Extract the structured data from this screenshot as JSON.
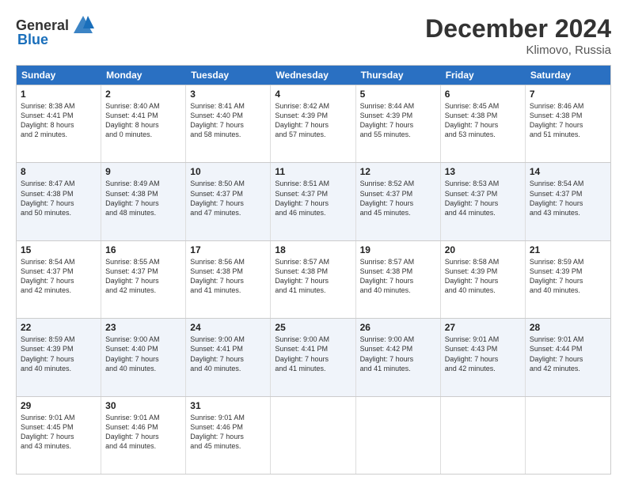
{
  "logo": {
    "general": "General",
    "blue": "Blue"
  },
  "title": "December 2024",
  "location": "Klimovo, Russia",
  "days_of_week": [
    "Sunday",
    "Monday",
    "Tuesday",
    "Wednesday",
    "Thursday",
    "Friday",
    "Saturday"
  ],
  "weeks": [
    [
      {
        "day": "1",
        "sunrise": "8:38 AM",
        "sunset": "4:41 PM",
        "daylight": "8 hours and 2 minutes."
      },
      {
        "day": "2",
        "sunrise": "8:40 AM",
        "sunset": "4:41 PM",
        "daylight": "8 hours and 0 minutes."
      },
      {
        "day": "3",
        "sunrise": "8:41 AM",
        "sunset": "4:40 PM",
        "daylight": "7 hours and 58 minutes."
      },
      {
        "day": "4",
        "sunrise": "8:42 AM",
        "sunset": "4:39 PM",
        "daylight": "7 hours and 57 minutes."
      },
      {
        "day": "5",
        "sunrise": "8:44 AM",
        "sunset": "4:39 PM",
        "daylight": "7 hours and 55 minutes."
      },
      {
        "day": "6",
        "sunrise": "8:45 AM",
        "sunset": "4:38 PM",
        "daylight": "7 hours and 53 minutes."
      },
      {
        "day": "7",
        "sunrise": "8:46 AM",
        "sunset": "4:38 PM",
        "daylight": "7 hours and 51 minutes."
      }
    ],
    [
      {
        "day": "8",
        "sunrise": "8:47 AM",
        "sunset": "4:38 PM",
        "daylight": "7 hours and 50 minutes."
      },
      {
        "day": "9",
        "sunrise": "8:49 AM",
        "sunset": "4:38 PM",
        "daylight": "7 hours and 48 minutes."
      },
      {
        "day": "10",
        "sunrise": "8:50 AM",
        "sunset": "4:37 PM",
        "daylight": "7 hours and 47 minutes."
      },
      {
        "day": "11",
        "sunrise": "8:51 AM",
        "sunset": "4:37 PM",
        "daylight": "7 hours and 46 minutes."
      },
      {
        "day": "12",
        "sunrise": "8:52 AM",
        "sunset": "4:37 PM",
        "daylight": "7 hours and 45 minutes."
      },
      {
        "day": "13",
        "sunrise": "8:53 AM",
        "sunset": "4:37 PM",
        "daylight": "7 hours and 44 minutes."
      },
      {
        "day": "14",
        "sunrise": "8:54 AM",
        "sunset": "4:37 PM",
        "daylight": "7 hours and 43 minutes."
      }
    ],
    [
      {
        "day": "15",
        "sunrise": "8:54 AM",
        "sunset": "4:37 PM",
        "daylight": "7 hours and 42 minutes."
      },
      {
        "day": "16",
        "sunrise": "8:55 AM",
        "sunset": "4:37 PM",
        "daylight": "7 hours and 42 minutes."
      },
      {
        "day": "17",
        "sunrise": "8:56 AM",
        "sunset": "4:38 PM",
        "daylight": "7 hours and 41 minutes."
      },
      {
        "day": "18",
        "sunrise": "8:57 AM",
        "sunset": "4:38 PM",
        "daylight": "7 hours and 41 minutes."
      },
      {
        "day": "19",
        "sunrise": "8:57 AM",
        "sunset": "4:38 PM",
        "daylight": "7 hours and 40 minutes."
      },
      {
        "day": "20",
        "sunrise": "8:58 AM",
        "sunset": "4:39 PM",
        "daylight": "7 hours and 40 minutes."
      },
      {
        "day": "21",
        "sunrise": "8:59 AM",
        "sunset": "4:39 PM",
        "daylight": "7 hours and 40 minutes."
      }
    ],
    [
      {
        "day": "22",
        "sunrise": "8:59 AM",
        "sunset": "4:39 PM",
        "daylight": "7 hours and 40 minutes."
      },
      {
        "day": "23",
        "sunrise": "9:00 AM",
        "sunset": "4:40 PM",
        "daylight": "7 hours and 40 minutes."
      },
      {
        "day": "24",
        "sunrise": "9:00 AM",
        "sunset": "4:41 PM",
        "daylight": "7 hours and 40 minutes."
      },
      {
        "day": "25",
        "sunrise": "9:00 AM",
        "sunset": "4:41 PM",
        "daylight": "7 hours and 41 minutes."
      },
      {
        "day": "26",
        "sunrise": "9:00 AM",
        "sunset": "4:42 PM",
        "daylight": "7 hours and 41 minutes."
      },
      {
        "day": "27",
        "sunrise": "9:01 AM",
        "sunset": "4:43 PM",
        "daylight": "7 hours and 42 minutes."
      },
      {
        "day": "28",
        "sunrise": "9:01 AM",
        "sunset": "4:44 PM",
        "daylight": "7 hours and 42 minutes."
      }
    ],
    [
      {
        "day": "29",
        "sunrise": "9:01 AM",
        "sunset": "4:45 PM",
        "daylight": "7 hours and 43 minutes."
      },
      {
        "day": "30",
        "sunrise": "9:01 AM",
        "sunset": "4:46 PM",
        "daylight": "7 hours and 44 minutes."
      },
      {
        "day": "31",
        "sunrise": "9:01 AM",
        "sunset": "4:46 PM",
        "daylight": "7 hours and 45 minutes."
      },
      null,
      null,
      null,
      null
    ]
  ]
}
